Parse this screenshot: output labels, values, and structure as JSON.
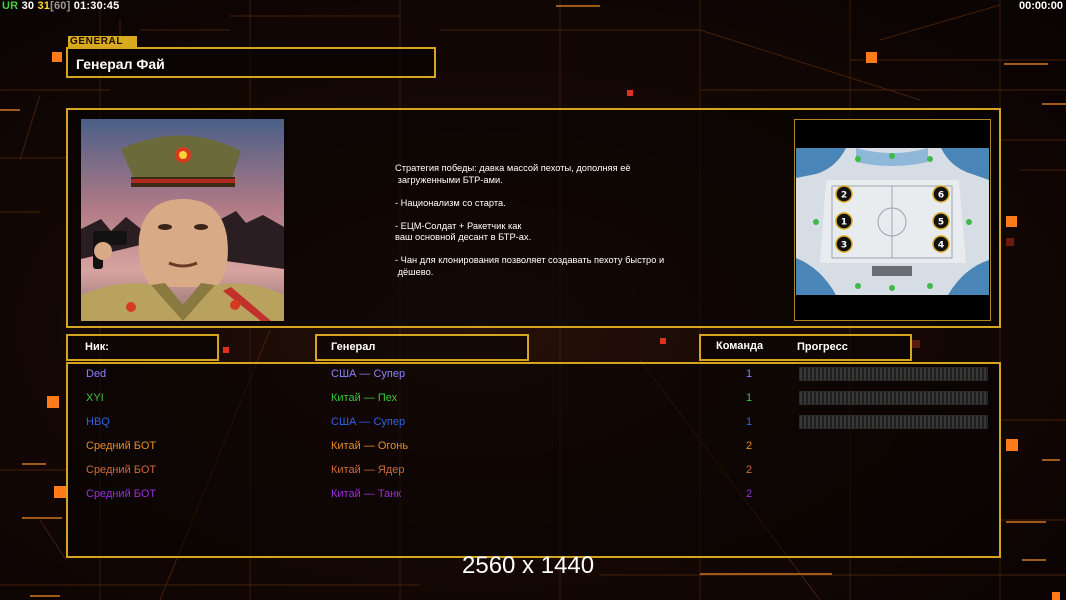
{
  "status_bar": {
    "ur_label": "UR",
    "value_a": "30",
    "value_b": "31",
    "value_c": "[60]",
    "clock": "01:30:45",
    "timer": "00:00:00"
  },
  "general": {
    "section_tag": "GENERAL",
    "name": "Генерал Фай",
    "portrait_icon": "general-fai-portrait",
    "description": [
      "Стратегия победы: давка массой пехоты, дополняя её",
      " загруженными БТР-ами.",
      "",
      "- Национализм со старта.",
      "",
      "- ЕЦМ-Солдат + Ракетчик как",
      "ваш основной десант в БТР-ах.",
      "",
      "- Чан для клонирования позволяет создавать пехоту быстро и",
      " дёшево."
    ]
  },
  "map_preview": {
    "icon": "snow-map-preview",
    "start_positions": [
      "1",
      "2",
      "3",
      "4",
      "5",
      "6"
    ]
  },
  "table": {
    "headers": {
      "nick": "Ник:",
      "general": "Генерал",
      "team": "Команда",
      "progress": "Прогресс"
    },
    "players": [
      {
        "nick": "Ded",
        "general": "США — Супер",
        "team": "1",
        "progress": 0,
        "color": "#8a82ff"
      },
      {
        "nick": "XYI",
        "general": "Китай — Пех",
        "team": "1",
        "progress": 0,
        "color": "#3dc43d"
      },
      {
        "nick": "HBQ",
        "general": "США — Супер",
        "team": "1",
        "progress": 0,
        "color": "#2f63e6"
      },
      {
        "nick": "Средний БОТ",
        "general": "Китай — Огонь",
        "team": "2",
        "color": "#e88a28"
      },
      {
        "nick": "Средний БОТ",
        "general": "Китай — Ядер",
        "team": "2",
        "color": "#d16a3c"
      },
      {
        "nick": "Средний БОТ",
        "general": "Китай — Танк",
        "team": "2",
        "color": "#9a2ee0"
      }
    ]
  },
  "resolution_text": "2560 x 1440",
  "colors": {
    "frame_gold": "#d5a51f",
    "accent_orange": "#ff7a18"
  }
}
